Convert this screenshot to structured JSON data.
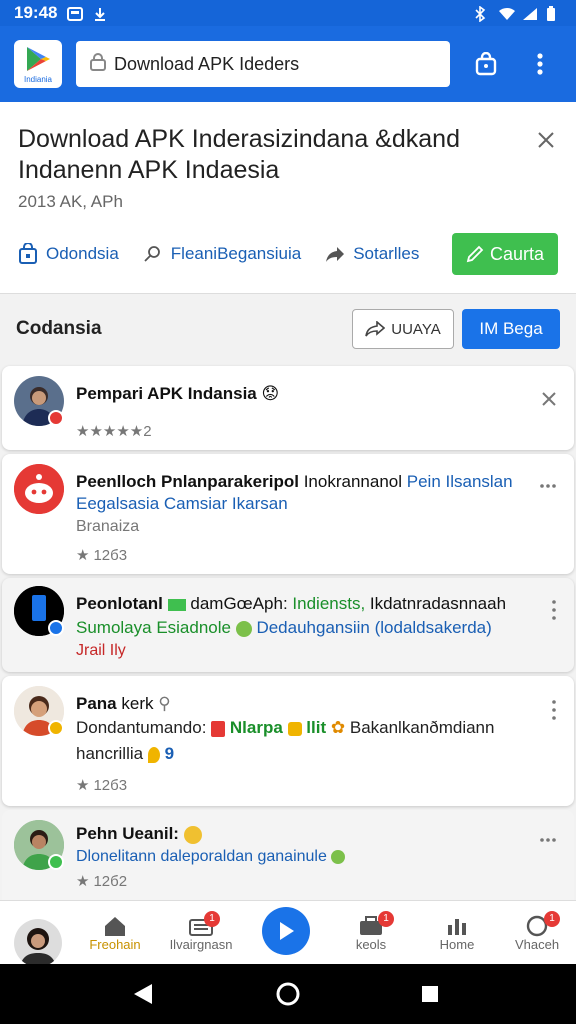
{
  "status_bar": {
    "time": "19:48"
  },
  "top_bar": {
    "logo_label": "Indiania",
    "url_text": "Download APK Ideders"
  },
  "header": {
    "title_line1": "Download APK Inderasizindana &dkand",
    "title_line2": "Indanenn APK Indaesia",
    "subtitle": "2013 AK, APh",
    "actions": [
      {
        "label": "Odondsia",
        "icon": "bag-icon"
      },
      {
        "label": "FleaniBegansiuia",
        "icon": "search-icon"
      },
      {
        "label": "Sotarlles",
        "icon": "share-icon"
      }
    ],
    "cta_label": "Caurta"
  },
  "feed": {
    "title": "Codansia",
    "sort_label": "UUAYA",
    "begin_label": "IM Bega",
    "items": [
      {
        "title": "Pempari APK Indansia",
        "title_emoji": "😟",
        "rating": "★★★★★2"
      },
      {
        "title_bold": "Peenlloch Pnlanparakeripol",
        "title_light": "Inokrannanol",
        "title_blue": "Pein Ilsanslan",
        "line2": "Eegalsasia Camsiar Ikarsan",
        "line3": "Branaiza",
        "rating": "12б3"
      },
      {
        "title_bold": "Peonlotanl",
        "title_light": "damGœAph:",
        "title_green": "Indiensts,",
        "title_tail": "Ikdatnradasnnaah",
        "line2_green": "Sumolaya Esiadnole",
        "line2_blue": "Dedauhgansiin (lodaldsakerda)",
        "line3": "Jrail Ily"
      },
      {
        "title_bold": "Pana",
        "title_light": "kerk",
        "line2_start": "Dondantumando:",
        "line2_green": "Nlarpa",
        "line2_green2": "llit",
        "line2_end": "Bakanlkanðmdiann",
        "line3": "hancrillia",
        "rating": "12б3"
      },
      {
        "title": "Pehn Ueanil:",
        "line2": "Dlonelitann daleporaldan ganainule",
        "rating": "12б2"
      }
    ]
  },
  "bottom_nav": {
    "items": [
      {
        "label": "Freohain",
        "icon": "home-icon",
        "active": true
      },
      {
        "label": "Ilvairgnasn",
        "icon": "inbox-icon",
        "badge": "1"
      },
      {
        "label": "keols",
        "icon": "tools-icon",
        "badge": "1"
      },
      {
        "label": "Home",
        "icon": "chart-icon"
      },
      {
        "label": "Vhaceh",
        "icon": "chat-icon",
        "badge": "1"
      }
    ]
  },
  "colors": {
    "primary": "#1a6be0",
    "accent_green": "#3fbf4f",
    "link_blue": "#1a5fb4",
    "active_nav": "#c89200"
  }
}
